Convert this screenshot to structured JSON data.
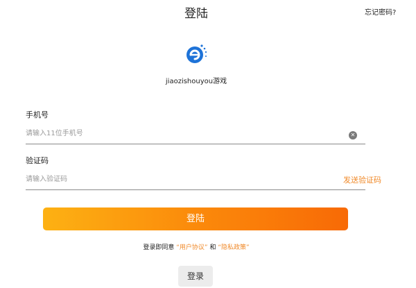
{
  "header": {
    "title": "登陆",
    "forgot_password": "忘记密码?"
  },
  "brand": {
    "logo_icon": "brand-logo-icon",
    "name": "jiaozishouyou游戏"
  },
  "form": {
    "phone": {
      "label": "手机号",
      "placeholder": "请输入11位手机号",
      "value": "",
      "clear_icon": "clear-icon"
    },
    "code": {
      "label": "验证码",
      "placeholder": "请输入验证码",
      "value": "",
      "send_label": "发送验证码"
    }
  },
  "submit_label": "登陆",
  "agreement": {
    "prefix": "登录即同意",
    "user_agreement": "“用户协议”",
    "and": "和",
    "privacy_policy": "“隐私政策”"
  },
  "secondary_login_label": "登录",
  "colors": {
    "accent": "#f08a2a",
    "gradient_start": "#fdb113",
    "gradient_end": "#f86a06",
    "logo_blue": "#1e73d8"
  }
}
